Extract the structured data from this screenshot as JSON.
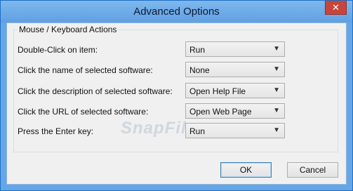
{
  "window": {
    "title": "Advanced Options",
    "close_glyph": "✕",
    "close_icon": "close-icon"
  },
  "group": {
    "legend": "Mouse / Keyboard Actions"
  },
  "rows": [
    {
      "label": "Double-Click on item:",
      "value": "Run"
    },
    {
      "label": "Click the name of selected software:",
      "value": "None"
    },
    {
      "label": "Click the description of selected software:",
      "value": "Open Help File"
    },
    {
      "label": "Click the URL of selected software:",
      "value": "Open Web Page"
    },
    {
      "label": "Press the Enter key:",
      "value": "Run"
    }
  ],
  "arrow_glyph": "▼",
  "watermark": "SnapFiles",
  "buttons": {
    "ok": "OK",
    "cancel": "Cancel"
  },
  "colors": {
    "titlebar": "#66a6e6",
    "close": "#c9453b",
    "dialog_bg": "#f0f0f0"
  }
}
